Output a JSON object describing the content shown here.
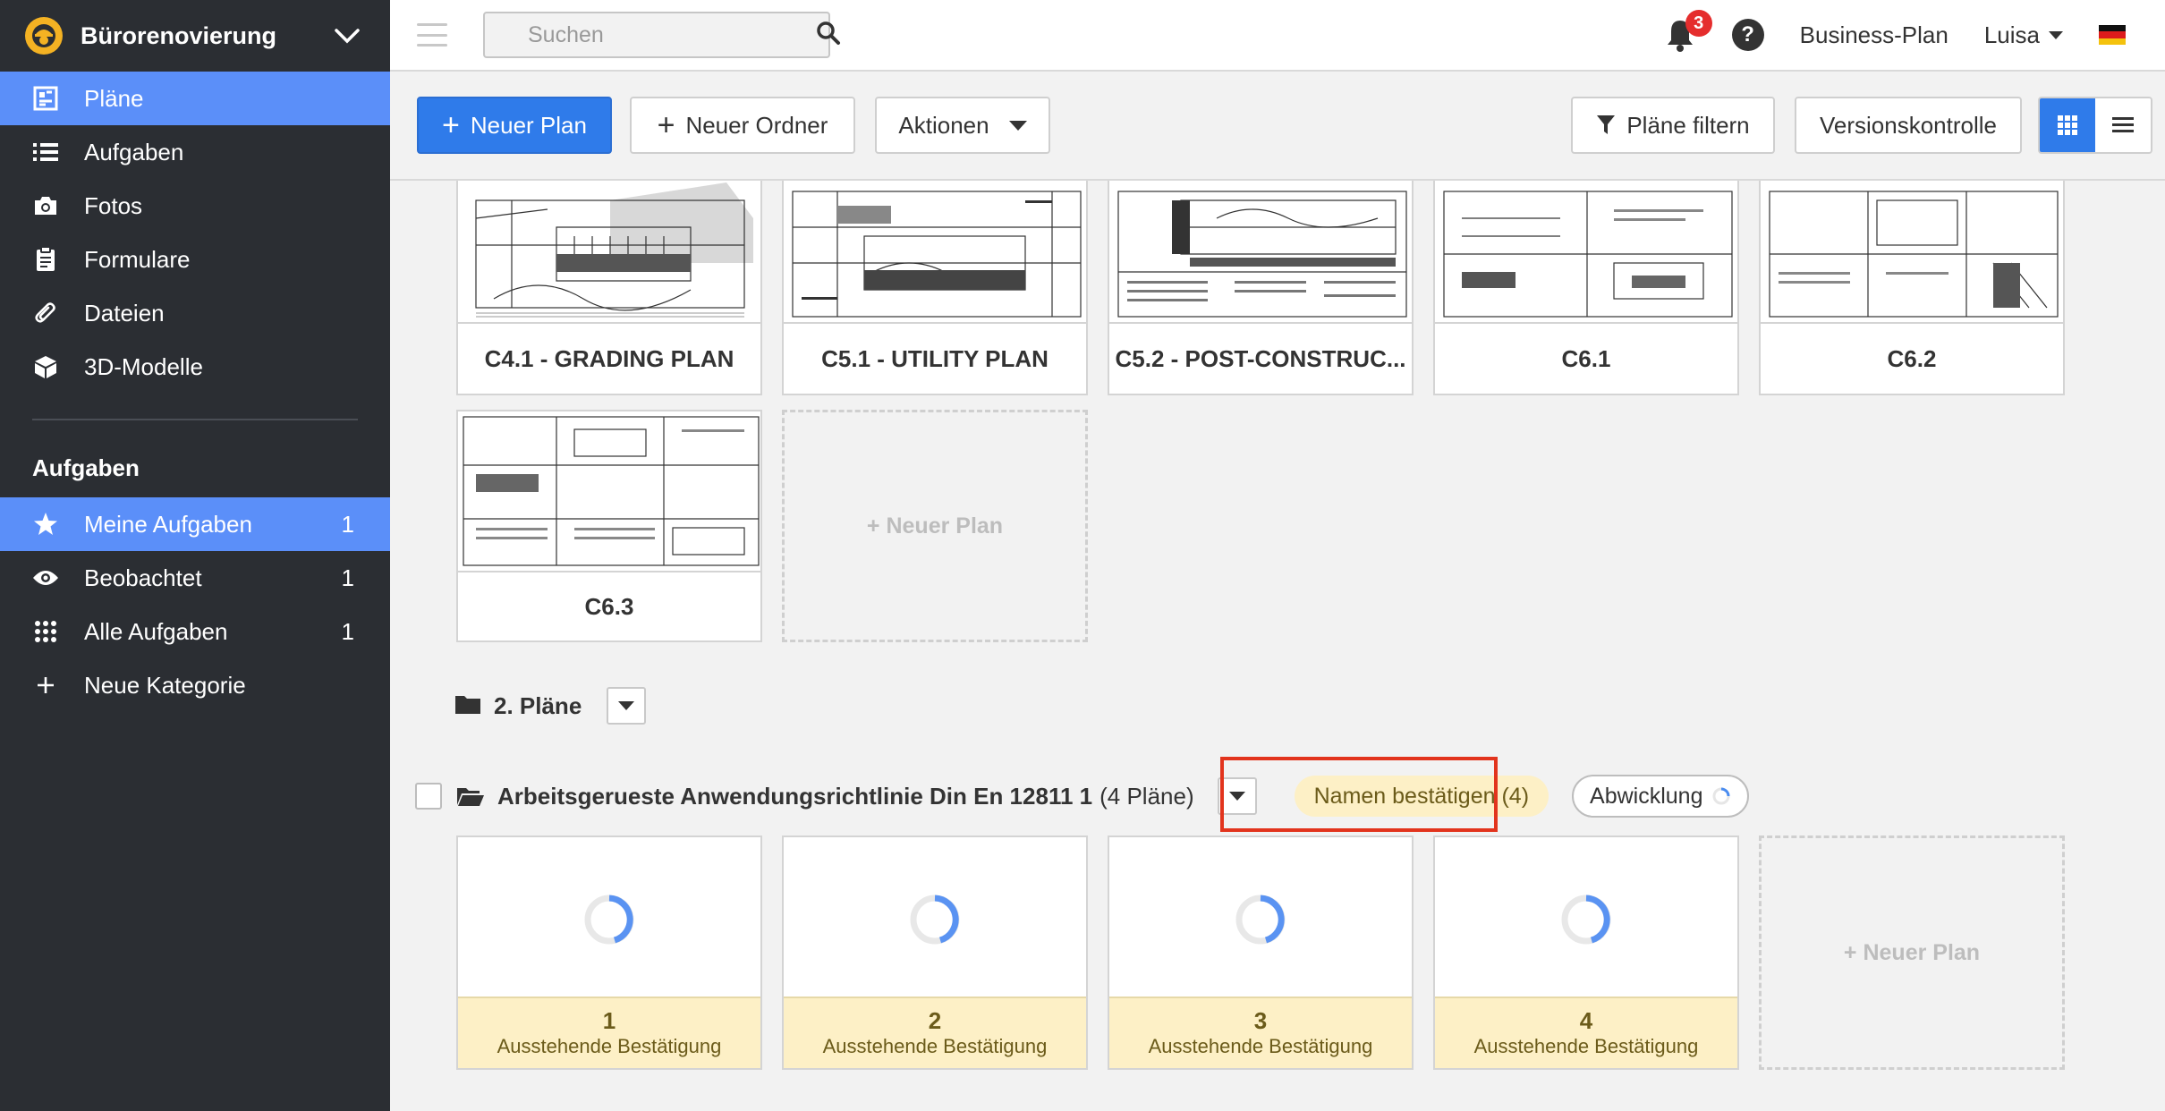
{
  "project": {
    "name": "Bürorenovierung"
  },
  "sidebar": {
    "nav": [
      {
        "label": "Pläne",
        "icon": "plans-icon"
      },
      {
        "label": "Aufgaben",
        "icon": "list-icon"
      },
      {
        "label": "Fotos",
        "icon": "camera-icon"
      },
      {
        "label": "Formulare",
        "icon": "clipboard-icon"
      },
      {
        "label": "Dateien",
        "icon": "paperclip-icon"
      },
      {
        "label": "3D-Modelle",
        "icon": "cube-icon"
      }
    ],
    "section_title": "Aufgaben",
    "tasks": [
      {
        "label": "Meine Aufgaben",
        "count": "1",
        "icon": "star-icon"
      },
      {
        "label": "Beobachtet",
        "count": "1",
        "icon": "eye-icon"
      },
      {
        "label": "Alle Aufgaben",
        "count": "1",
        "icon": "grid-dots-icon"
      },
      {
        "label": "Neue Kategorie",
        "icon": "plus-icon"
      }
    ]
  },
  "topbar": {
    "search_placeholder": "Suchen",
    "notifications_count": "3",
    "help_label": "?",
    "plan_link": "Business-Plan",
    "user": "Luisa",
    "language_flag": "german-flag-icon"
  },
  "toolbar": {
    "new_plan": "Neuer Plan",
    "new_folder": "Neuer Ordner",
    "actions": "Aktionen",
    "filter": "Pläne filtern",
    "version_control": "Versionskontrolle",
    "view_mode": "grid"
  },
  "plans_top": [
    {
      "name": "C4.1 - GRADING PLAN"
    },
    {
      "name": "C5.1 - UTILITY PLAN"
    },
    {
      "name": "C5.2 - POST-CONSTRUC..."
    },
    {
      "name": "C6.1"
    },
    {
      "name": "C6.2"
    },
    {
      "name": "C6.3"
    }
  ],
  "new_plan_tile": "+ Neuer Plan",
  "folder_2": {
    "title": "2. Pläne"
  },
  "folder_3": {
    "title": "Arbeitsgerueste Anwendungsrichtlinie Din En 12811 1",
    "count_label": "(4 Pläne)",
    "confirm_names": "Namen bestätigen (4)",
    "processing": "Abwicklung",
    "plans": [
      {
        "number": "1",
        "status": "Ausstehende Bestätigung"
      },
      {
        "number": "2",
        "status": "Ausstehende Bestätigung"
      },
      {
        "number": "3",
        "status": "Ausstehende Bestätigung"
      },
      {
        "number": "4",
        "status": "Ausstehende Bestätigung"
      }
    ]
  },
  "colors": {
    "accent": "#2f7bea",
    "sidebar": "#2b2e33",
    "active": "#5b8ff9",
    "pending": "#fdf0c6",
    "highlight": "#e2341d"
  }
}
